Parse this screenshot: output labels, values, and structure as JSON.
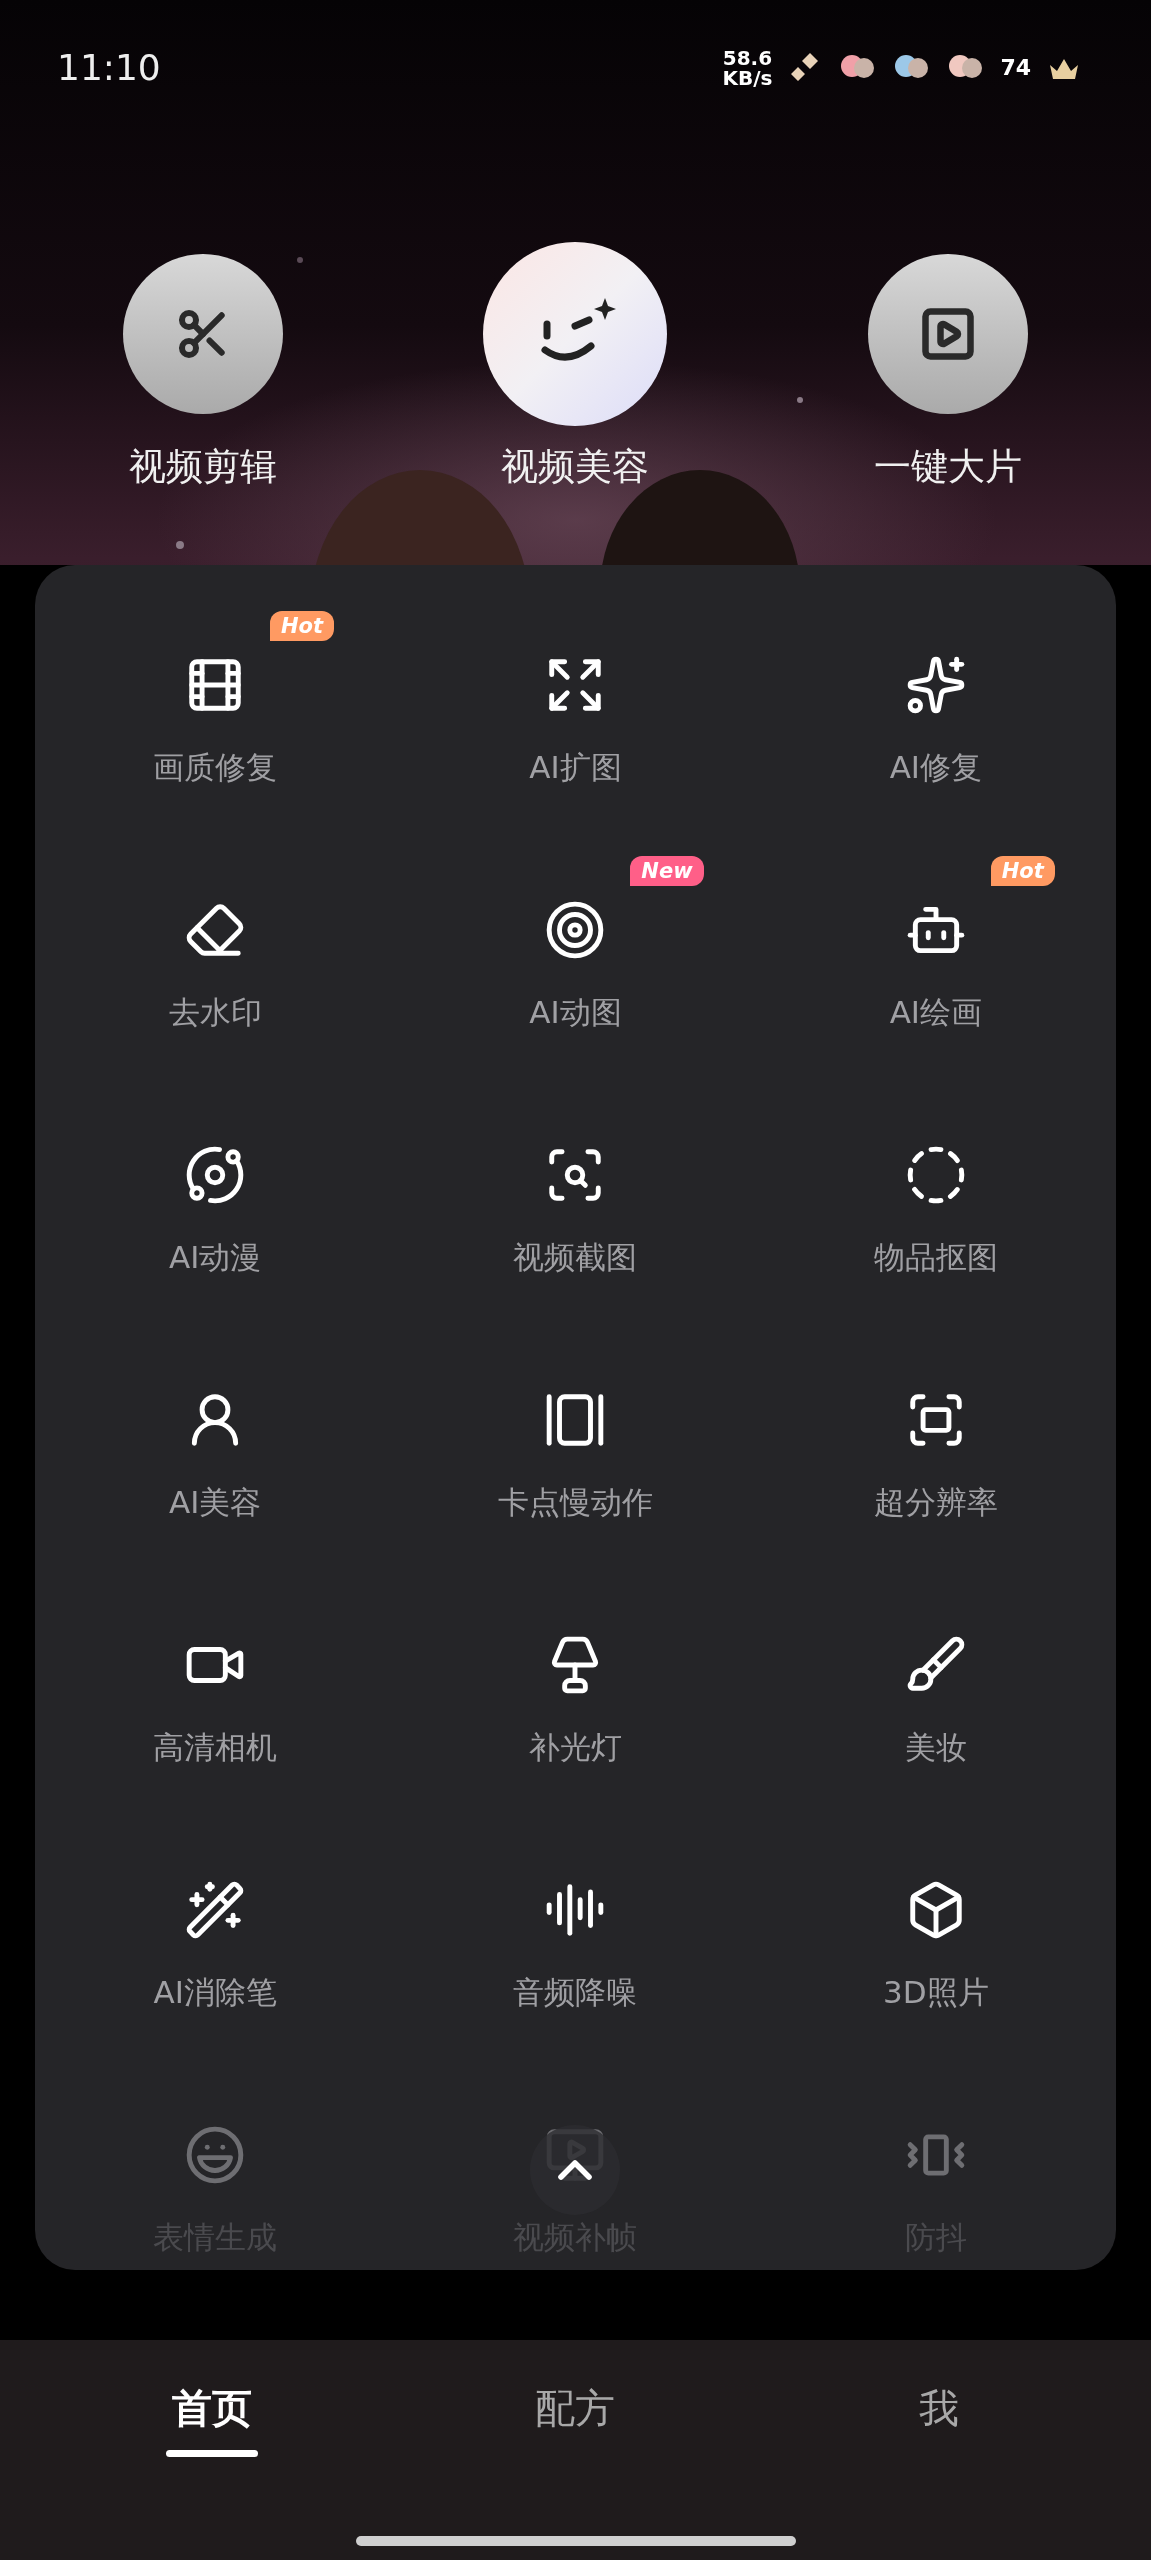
{
  "status_bar": {
    "time": "11:10",
    "net_speed": "58.6",
    "net_unit": "KB/s",
    "battery": "74"
  },
  "quick_actions": [
    {
      "label": "视频剪辑",
      "kind": "scissors",
      "featured": false
    },
    {
      "label": "视频美容",
      "kind": "wink",
      "featured": true
    },
    {
      "label": "一键大片",
      "kind": "play",
      "featured": false
    }
  ],
  "tools": [
    {
      "label": "画质修复",
      "kind": "hd",
      "badge": {
        "text": "Hot",
        "color": "#ff9a62"
      },
      "faded": false
    },
    {
      "label": "AI扩图",
      "kind": "expand",
      "faded": false
    },
    {
      "label": "AI修复",
      "kind": "sparkles",
      "faded": false
    },
    {
      "label": "去水印",
      "kind": "eraser",
      "faded": false
    },
    {
      "label": "AI动图",
      "kind": "target",
      "badge": {
        "text": "New",
        "color": "#ff5f88"
      },
      "faded": false
    },
    {
      "label": "AI绘画",
      "kind": "bot",
      "badge": {
        "text": "Hot",
        "color": "#ff9a62"
      },
      "faded": false
    },
    {
      "label": "AI动漫",
      "kind": "orbit",
      "faded": false
    },
    {
      "label": "视频截图",
      "kind": "scan",
      "faded": false
    },
    {
      "label": "物品抠图",
      "kind": "circle",
      "faded": false
    },
    {
      "label": "AI美容",
      "kind": "user",
      "faded": false
    },
    {
      "label": "卡点慢动作",
      "kind": "cards",
      "faded": false
    },
    {
      "label": "超分辨率",
      "kind": "uhd",
      "faded": false
    },
    {
      "label": "高清相机",
      "kind": "camera",
      "faded": false
    },
    {
      "label": "补光灯",
      "kind": "lamp",
      "faded": false
    },
    {
      "label": "美妆",
      "kind": "brush",
      "faded": false
    },
    {
      "label": "AI消除笔",
      "kind": "wand",
      "faded": false
    },
    {
      "label": "音频降噪",
      "kind": "audio",
      "faded": false
    },
    {
      "label": "3D照片",
      "kind": "box",
      "faded": false
    },
    {
      "label": "表情生成",
      "kind": "laugh",
      "faded": true
    },
    {
      "label": "视频补帧",
      "kind": "monitor",
      "faded": true
    },
    {
      "label": "防抖",
      "kind": "vibrate",
      "faded": true
    }
  ],
  "nav_tabs": [
    {
      "label": "首页",
      "selected": true
    },
    {
      "label": "配方",
      "selected": false
    },
    {
      "label": "我",
      "selected": false
    }
  ]
}
